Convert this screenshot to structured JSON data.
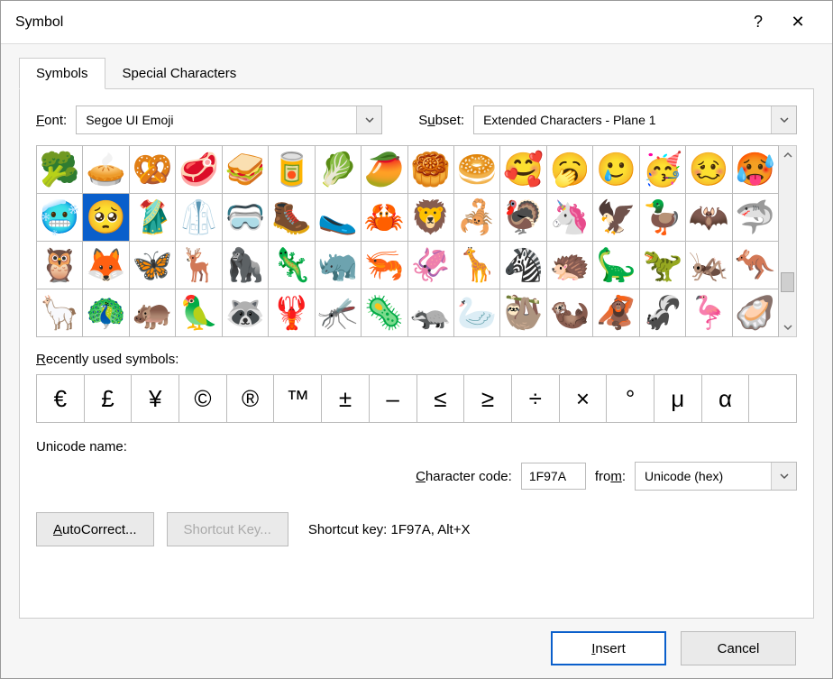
{
  "titlebar": {
    "title": "Symbol",
    "help": "?",
    "close": "✕"
  },
  "tabs": {
    "symbols": "Symbols",
    "special": "Special Characters"
  },
  "labels": {
    "font": "Font:",
    "subset": "Subset:",
    "recent": "Recently used symbols:",
    "unicode_name": "Unicode name:",
    "charcode": "Character code:",
    "from": "from:",
    "shortcut_label": "Shortcut key: 1F97A, Alt+X"
  },
  "font_value": "Segoe UI Emoji",
  "subset_value": "Extended Characters - Plane 1",
  "charcode_value": "1F97A",
  "from_value": "Unicode (hex)",
  "buttons": {
    "autocorrect": "AutoCorrect...",
    "shortcut": "Shortcut Key...",
    "insert": "Insert",
    "cancel": "Cancel"
  },
  "selected_index": 17,
  "symbols_grid": [
    "🥦",
    "🥧",
    "🥨",
    "🥩",
    "🥪",
    "🥫",
    "🥬",
    "🥭",
    "🥮",
    "🥯",
    "🥰",
    "🥱",
    "🥲",
    "🥳",
    "🥴",
    "🥵",
    "🥶",
    "🥺",
    "🥻",
    "🥼",
    "🥽",
    "🥾",
    "🥿",
    "🦀",
    "🦁",
    "🦂",
    "🦃",
    "🦄",
    "🦅",
    "🦆",
    "🦇",
    "🦈",
    "🦉",
    "🦊",
    "🦋",
    "🦌",
    "🦍",
    "🦎",
    "🦏",
    "🦐",
    "🦑",
    "🦒",
    "🦓",
    "🦔",
    "🦕",
    "🦖",
    "🦗",
    "🦘",
    "🦙",
    "🦚",
    "🦛",
    "🦜",
    "🦝",
    "🦞",
    "🦟",
    "🦠",
    "🦡",
    "🦢",
    "🦥",
    "🦦",
    "🦧",
    "🦨",
    "🦩",
    "🦪"
  ],
  "recent_symbols": [
    "€",
    "£",
    "¥",
    "©",
    "®",
    "™",
    "±",
    "–",
    "≤",
    "≥",
    "÷",
    "×",
    "°",
    "μ",
    "α",
    ""
  ]
}
